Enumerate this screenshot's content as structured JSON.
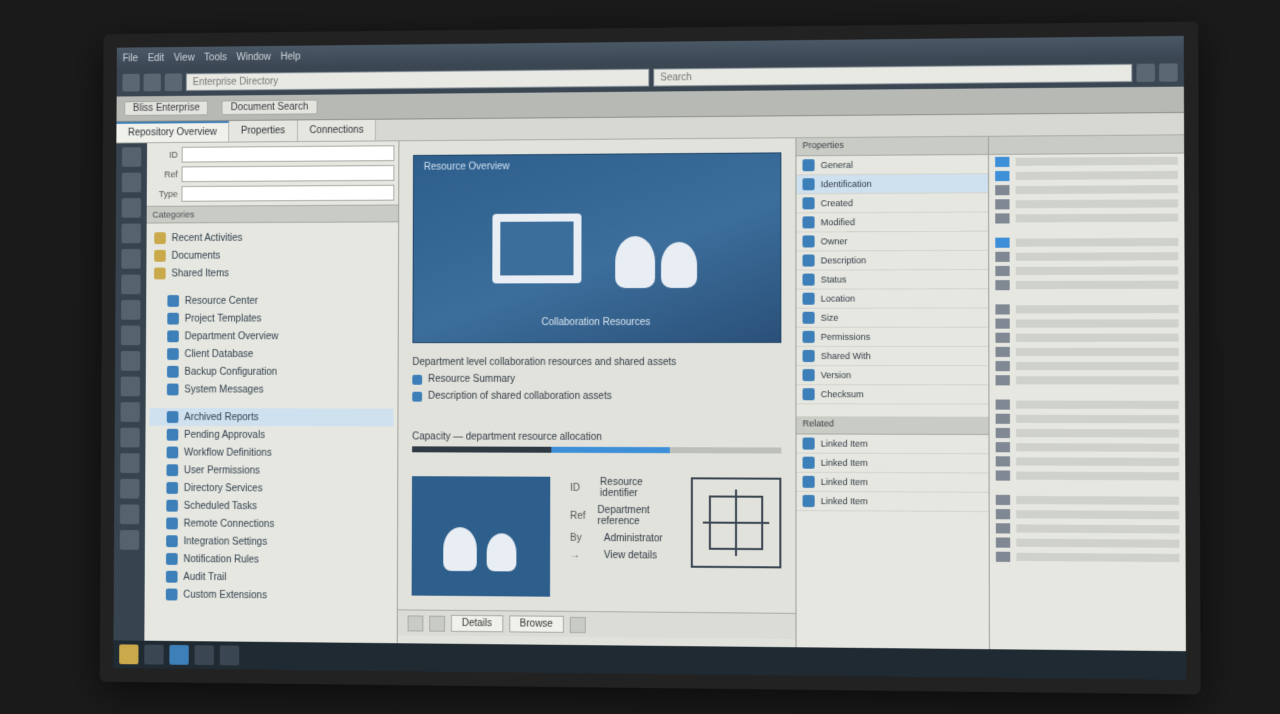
{
  "menubar": {
    "items": [
      "File",
      "Edit",
      "View",
      "Tools",
      "Window",
      "Help"
    ]
  },
  "addressbar": {
    "main_placeholder": "Enterprise Directory",
    "search_placeholder": "Search"
  },
  "ribbon": {
    "app_title": "Bliss Enterprise",
    "doc_title": "Document Search"
  },
  "tabstrip": {
    "tabs": [
      {
        "label": "Repository Overview"
      },
      {
        "label": "Properties"
      },
      {
        "label": "Connections"
      }
    ]
  },
  "navpane": {
    "field1_label": "ID",
    "field1_value": "",
    "field2_label": "Ref",
    "field2_value": "",
    "field3_label": "Type",
    "field3_value": "",
    "categories_label": "Categories",
    "items": [
      {
        "label": "Recent Activities",
        "kind": "folder"
      },
      {
        "label": "Documents",
        "kind": "folder"
      },
      {
        "label": "Shared Items",
        "kind": "folder"
      },
      {
        "label": "Resource Center",
        "kind": "item"
      },
      {
        "label": "Project Templates",
        "kind": "item"
      },
      {
        "label": "Department Overview",
        "kind": "item"
      },
      {
        "label": "Client Database",
        "kind": "item"
      },
      {
        "label": "Backup Configuration",
        "kind": "item"
      },
      {
        "label": "System Messages",
        "kind": "item"
      },
      {
        "label": "Archived Reports",
        "kind": "item",
        "sel": true
      },
      {
        "label": "Pending Approvals",
        "kind": "item"
      },
      {
        "label": "Workflow Definitions",
        "kind": "item"
      },
      {
        "label": "User Permissions",
        "kind": "item"
      },
      {
        "label": "Directory Services",
        "kind": "item"
      },
      {
        "label": "Scheduled Tasks",
        "kind": "item"
      },
      {
        "label": "Remote Connections",
        "kind": "item"
      },
      {
        "label": "Integration Settings",
        "kind": "item"
      },
      {
        "label": "Notification Rules",
        "kind": "item"
      },
      {
        "label": "Audit Trail",
        "kind": "item"
      },
      {
        "label": "Custom Extensions",
        "kind": "item"
      }
    ]
  },
  "banner": {
    "title": "Resource Overview",
    "caption": "Collaboration Resources"
  },
  "desc": {
    "headline": "Department level collaboration resources and shared assets",
    "lines": [
      "Resource Summary",
      "Description of shared collaboration assets"
    ]
  },
  "progress": {
    "label": "Capacity — department resource allocation"
  },
  "card_meta": {
    "rows": [
      {
        "k": "ID",
        "v": "Resource identifier"
      },
      {
        "k": "Ref",
        "v": "Department reference"
      },
      {
        "k": "By",
        "v": "Administrator"
      },
      {
        "k": "→",
        "v": "View details"
      }
    ]
  },
  "bottom_toolbar": {
    "btn1": "Details",
    "btn2": "Browse"
  },
  "proppane": {
    "header": "Properties",
    "rows": [
      "General",
      "Identification",
      "Created",
      "Modified",
      "Owner",
      "Description",
      "Status",
      "Location",
      "Size",
      "Permissions",
      "Shared With",
      "Version",
      "Checksum"
    ],
    "header2": "Related",
    "rows2": [
      "Linked Item",
      "Linked Item",
      "Linked Item",
      "Linked Item"
    ]
  },
  "rightpane": {
    "groups": [
      {
        "count": 5,
        "hl": [
          0,
          1
        ]
      },
      {
        "count": 4,
        "hl": [
          0
        ]
      },
      {
        "count": 6,
        "hl": []
      },
      {
        "count": 6,
        "hl": []
      },
      {
        "count": 5,
        "hl": []
      }
    ]
  }
}
